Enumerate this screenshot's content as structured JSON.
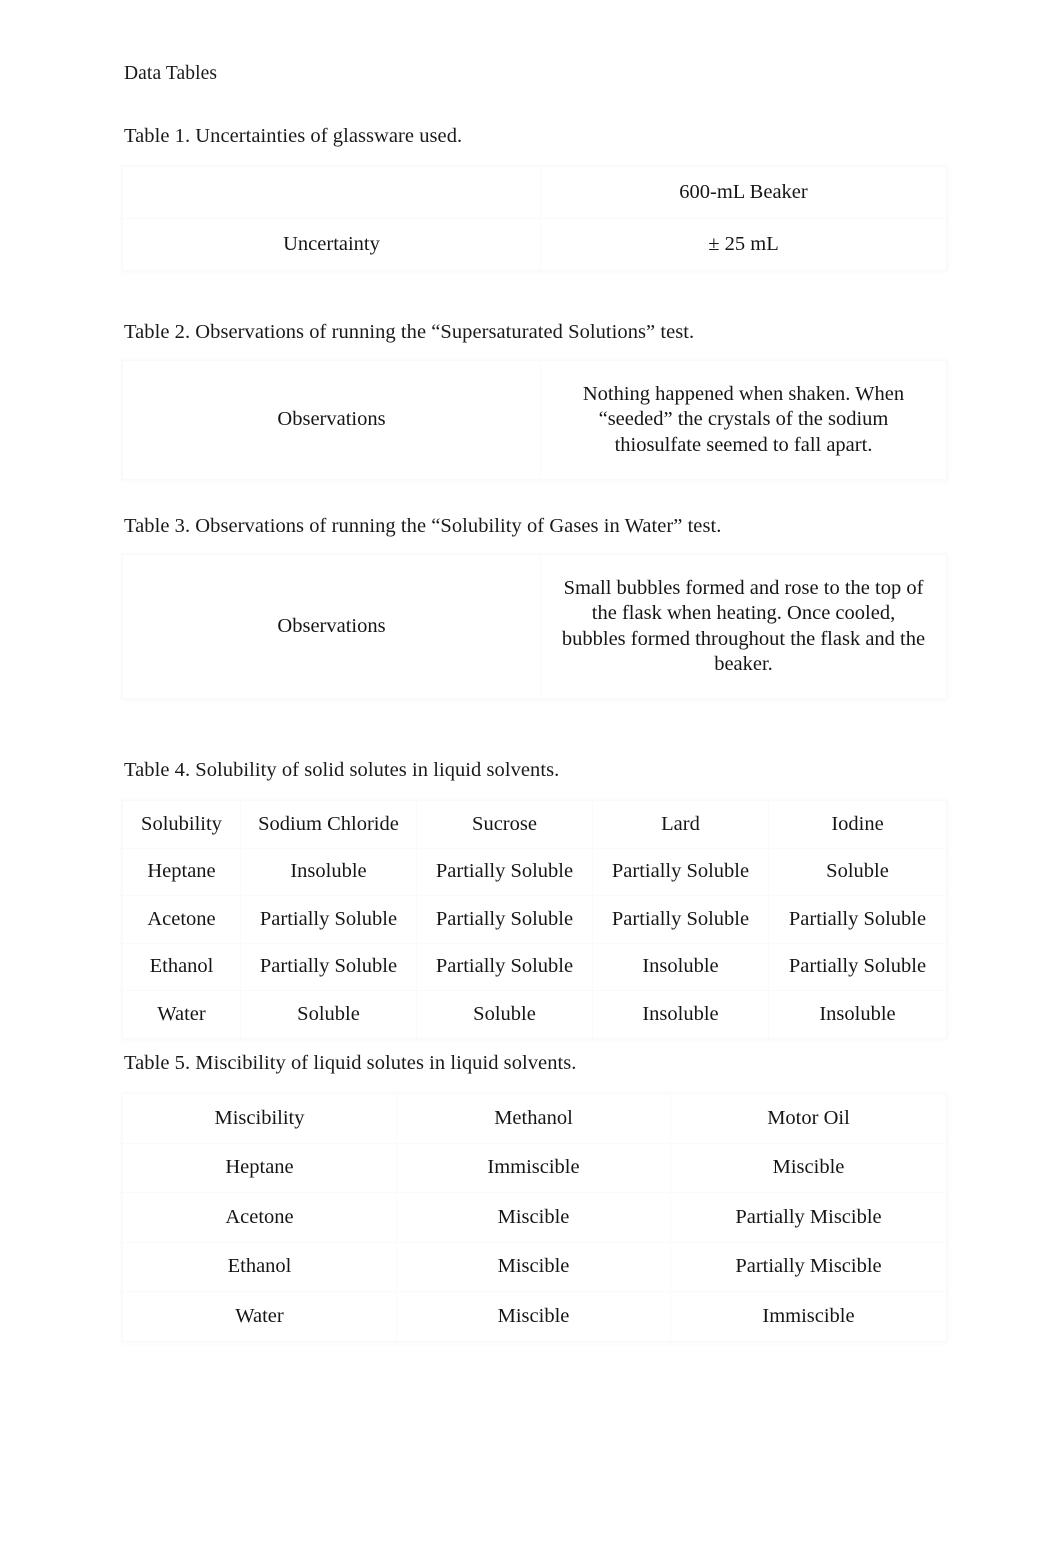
{
  "document": {
    "heading": "Data Tables"
  },
  "table1": {
    "caption": "Table 1. Uncertainties of glassware used.",
    "header": [
      "",
      "600-mL Beaker"
    ],
    "rows": [
      [
        "Uncertainty",
        "± 25 mL"
      ]
    ]
  },
  "table2": {
    "caption": "Table 2. Observations of running the “Supersaturated Solutions” test.",
    "rows": [
      [
        "Observations",
        "Nothing happened when shaken. When “seeded” the crystals of the sodium thiosulfate seemed to fall apart."
      ]
    ]
  },
  "table3": {
    "caption": "Table 3. Observations of running the “Solubility of Gases in Water” test.",
    "rows": [
      [
        "Observations",
        "Small bubbles formed and rose to the top of the flask when heating. Once cooled, bubbles formed throughout the flask and the beaker."
      ]
    ]
  },
  "table4": {
    "caption": "Table 4. Solubility of solid solutes in liquid solvents.",
    "header": [
      "Solubility",
      "Sodium Chloride",
      "Sucrose",
      "Lard",
      "Iodine"
    ],
    "rows": [
      [
        "Heptane",
        "Insoluble",
        "Partially Soluble",
        "Partially Soluble",
        "Soluble"
      ],
      [
        "Acetone",
        "Partially Soluble",
        "Partially Soluble",
        "Partially Soluble",
        "Partially Soluble"
      ],
      [
        "Ethanol",
        "Partially Soluble",
        "Partially Soluble",
        "Insoluble",
        "Partially Soluble"
      ],
      [
        "Water",
        "Soluble",
        "Soluble",
        "Insoluble",
        "Insoluble"
      ]
    ]
  },
  "table5": {
    "caption": "Table 5. Miscibility of liquid solutes in liquid solvents.",
    "header": [
      "Miscibility",
      "Methanol",
      "Motor Oil"
    ],
    "rows": [
      [
        "Heptane",
        "Immiscible",
        "Miscible"
      ],
      [
        "Acetone",
        "Miscible",
        "Partially Miscible"
      ],
      [
        "Ethanol",
        "Miscible",
        "Partially Miscible"
      ],
      [
        "Water",
        "Miscible",
        "Immiscible"
      ]
    ]
  }
}
